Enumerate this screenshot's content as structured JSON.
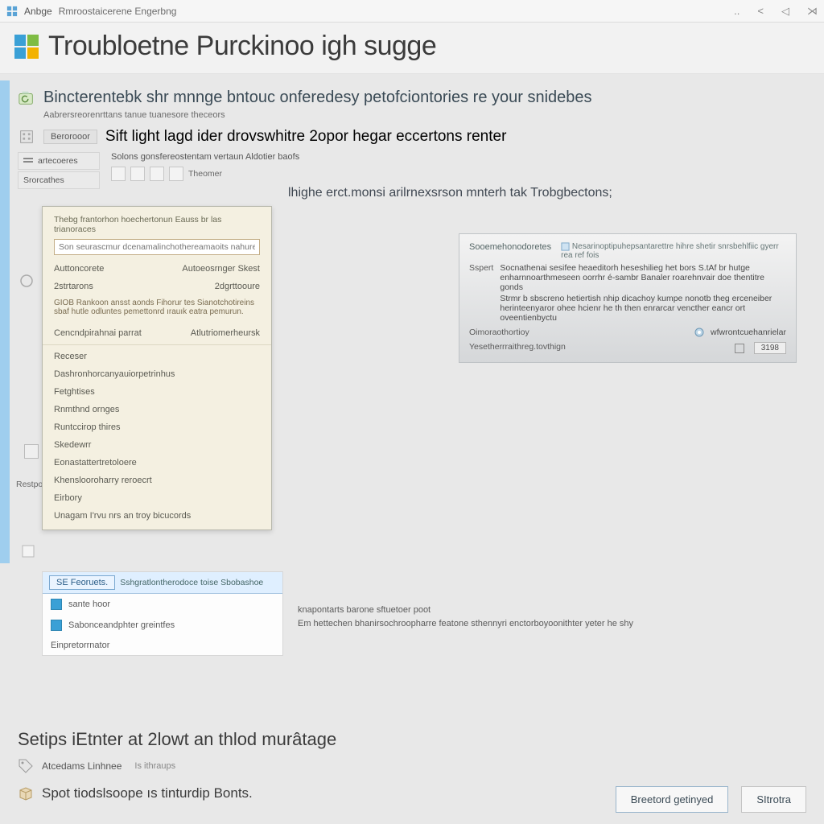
{
  "topbar": {
    "app": "Anbge",
    "breadcrumb": "Rmroostaicerene Engerbng",
    "right_glyphs": [
      "..",
      "<",
      "◁",
      "⋊"
    ]
  },
  "title": "Troubloetne Purckinoo igh sugge",
  "section1": {
    "title": "Bincterentebk shr mnnge bntouc onferedesy petofciontories re your snidebes",
    "sub": "Aabrersreorenrttans tanue tuanesore theceors"
  },
  "section2": {
    "badge": "Berorooor",
    "title": "Sift light lagd ider drovswhitre 2opor hegar eccertons renter",
    "sub": "Solons gonsfereostentam vertaun Aldotier baofs"
  },
  "nav": [
    {
      "label": "artecoeres"
    },
    {
      "label": "Srorcathes"
    }
  ],
  "toolbar_label": "Theomer",
  "heading_right": "lhighe erct.monsi arilrnexsrson mnterh tak Trobgbectons;",
  "info_card": {
    "title": "Sooemehonodoretes",
    "top_right": "Nesarinoptipuhepsantarettre hihre shetir snrsbehlfiic gyerr rea ref fois",
    "desc_label": "Sspert",
    "desc1": "Socnathenai sesifee heaeditorh heseshilieg het bors S.tAf br hutge enharnnoarthmeseen oorrhr é-sambr Banaler roarehnvair doe thentitre gonds",
    "desc2": "Strmr b sbscreno hetiertish nhip dicachoy kumpe nonotb theg erceneiber herinteenyaror ohee hcienr he th then enrarcar vencther eancr ort oveentienbyctu",
    "row1_label": "Oimoraothortioy",
    "row1_right": "wfwrontcuehanrielar",
    "row2_label": "Yesetherrraithreg.tovthign",
    "row2_btn": "3198"
  },
  "dropdown": {
    "head": "Thebg frantorhon hoechertonun Eauss br las trianoraces",
    "search_placeholder": "Son seurascmur dcenamalinchothereamaoits nahures",
    "cols": [
      [
        "Auttoncorete",
        "Autoeosrnger Skest"
      ],
      [
        "2strtarons",
        "2dgrttooure"
      ]
    ],
    "note": "GIOB Rankoon ansst aonds Fihorur tes Sianotchotireins sbaf hutle odluntes pemettonrd ırauık eatra pemurun.",
    "row3": [
      "Cencndpirahnai parrat",
      "Atlutriomerheursk"
    ],
    "items": [
      "Receser",
      "Dashronhorcanyauiorpetrinhus",
      "Fetghtises",
      "Rnmthnd ornges",
      "Runtccirop thires",
      "Skedewrr",
      "Eonastattertretoloere",
      "Khenslooroharry reroecrt",
      "Eirbory",
      "Unagam I'rvu nrs an troy bicucords"
    ]
  },
  "dd_below": {
    "selected": "SE Feoruets.",
    "right_text": "Sshgratlontherodoce toise Sbobashoe",
    "row1": "sante hoor",
    "row2": "Sabonceandphter greintfes",
    "row3": "Einpretorrnator"
  },
  "body_paragraph": {
    "l1": "knapontarts barone sftuetoer poot",
    "l2": "Em hettechen bhanirsochroopharre featone sthennyri enctorboyoonithter yeter he shy"
  },
  "bottom": {
    "heading": "Setips iEtnter at 2lowt an thlod murâtage",
    "row1": "Atcedams Linhnee",
    "row1_sub": "Is ithraups",
    "row2": "Spot tiodslsoope ıs tinturdip Bonts.",
    "btn_primary": "Breetord getinyed",
    "btn_secondary": "SItrotra"
  }
}
